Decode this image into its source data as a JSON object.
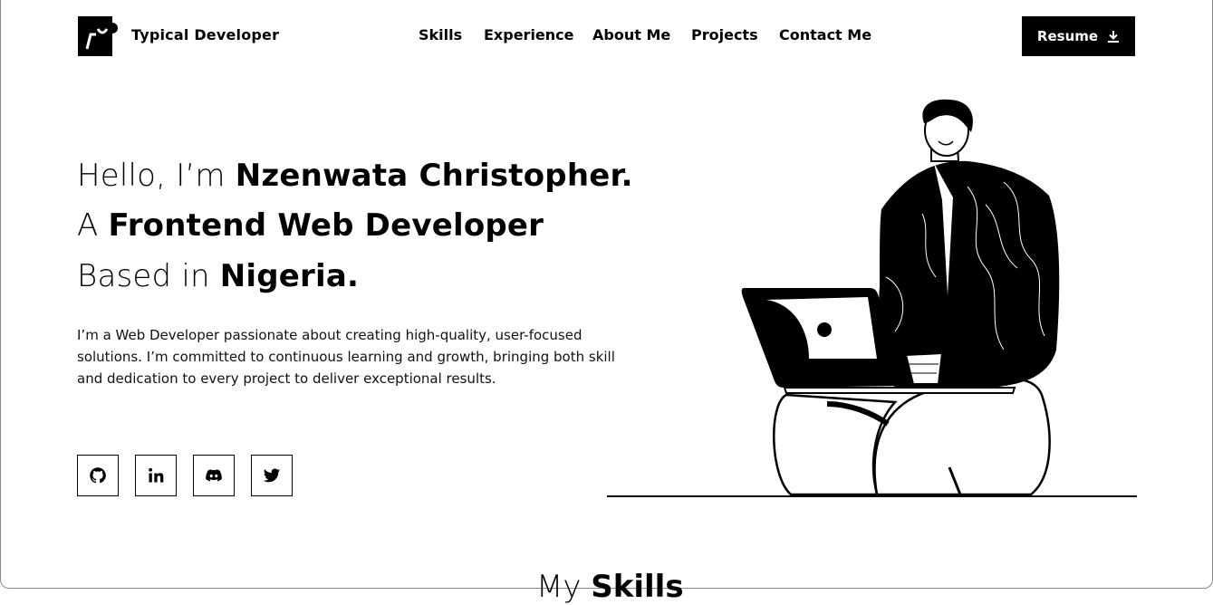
{
  "brand": {
    "name": "Typical Developer"
  },
  "nav": {
    "items": [
      "Skills",
      "Experience",
      "About Me",
      "Projects",
      "Contact Me"
    ]
  },
  "resume": {
    "label": "Resume"
  },
  "hero": {
    "line1_light": "Hello, I’m ",
    "line1_bold": "Nzenwata Christopher.",
    "line2_light": "A ",
    "line2_bold": "Frontend Web Developer",
    "line3_light": "Based in ",
    "line3_bold": "Nigeria.",
    "intro": "I’m a Web Developer passionate about creating high-quality, user-focused solutions. I’m committed to continuous learning and growth, bringing both skill and dedication to every project to deliver exceptional results."
  },
  "social": {
    "icons": [
      "github-icon",
      "linkedin-icon",
      "discord-icon",
      "twitter-icon"
    ]
  },
  "skills": {
    "title_light": "My ",
    "title_bold": "Skills"
  }
}
